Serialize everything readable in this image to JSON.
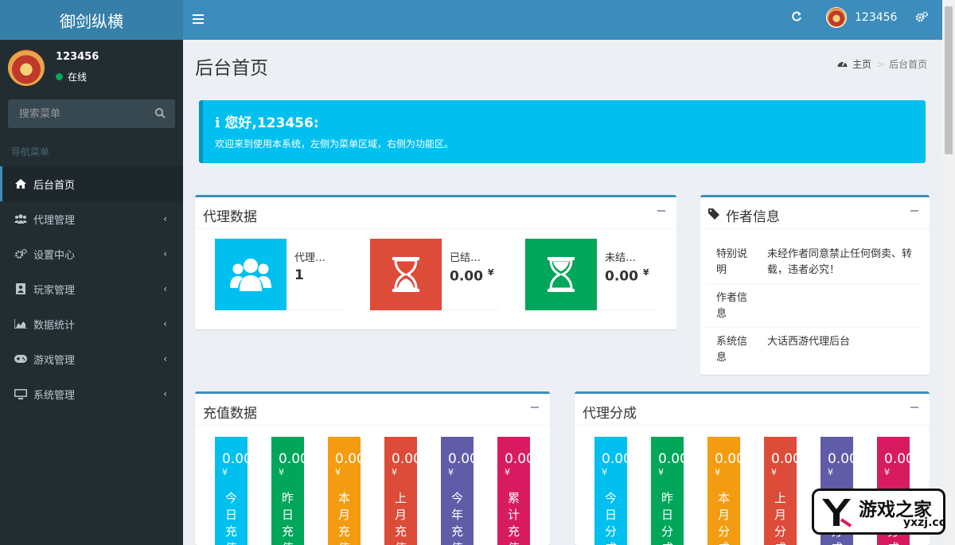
{
  "header": {
    "brand": "御剑纵横",
    "username": "123456"
  },
  "sidebar": {
    "user": {
      "name": "123456",
      "status": "在线"
    },
    "search_placeholder": "搜索菜单",
    "nav_header": "导航菜单",
    "items": [
      {
        "label": "后台首页",
        "icon": "home-icon",
        "active": true
      },
      {
        "label": "代理管理",
        "icon": "users-icon"
      },
      {
        "label": "设置中心",
        "icon": "cogs-icon"
      },
      {
        "label": "玩家管理",
        "icon": "contact-card-icon"
      },
      {
        "label": "数据统计",
        "icon": "area-chart-icon"
      },
      {
        "label": "游戏管理",
        "icon": "gamepad-icon"
      },
      {
        "label": "系统管理",
        "icon": "desktop-icon"
      }
    ]
  },
  "content": {
    "title": "后台首页",
    "breadcrumb": {
      "home": "主页",
      "current": "后台首页"
    },
    "callout": {
      "title": "您好,123456:",
      "text": "欢迎来到使用本系统，左侧为菜单区域，右侧为功能区。"
    },
    "agent_data": {
      "title": "代理数据",
      "boxes": [
        {
          "label": "代理…",
          "value": "1",
          "currency": "",
          "color": "#00c0ef",
          "icon": "users-icon"
        },
        {
          "label": "已结…",
          "value": "0.00",
          "currency": "¥",
          "color": "#dd4b39",
          "icon": "hourglass-end-icon"
        },
        {
          "label": "未结…",
          "value": "0.00",
          "currency": "¥",
          "color": "#00a65a",
          "icon": "hourglass-start-icon"
        }
      ]
    },
    "author_info": {
      "title": "作者信息",
      "rows": [
        {
          "key": "特别说明",
          "value": "未经作者同意禁止任何倒卖、转载，违者必究！"
        },
        {
          "key": "作者信息",
          "value": ""
        },
        {
          "key": "系统信息",
          "value": "大话西游代理后台"
        }
      ]
    },
    "recharge_data": {
      "title": "充值数据",
      "bars": [
        {
          "amount": "0.00",
          "currency": "¥",
          "label": "今日充值",
          "color": "#00c0ef"
        },
        {
          "amount": "0.00",
          "currency": "¥",
          "label": "昨日充值",
          "color": "#00a65a"
        },
        {
          "amount": "0.00",
          "currency": "¥",
          "label": "本月充值",
          "color": "#f39c12"
        },
        {
          "amount": "0.00",
          "currency": "¥",
          "label": "上月充值",
          "color": "#dd4b39"
        },
        {
          "amount": "0.00",
          "currency": "¥",
          "label": "今年充值",
          "color": "#605ca8"
        },
        {
          "amount": "0.00",
          "currency": "¥",
          "label": "累计充值",
          "color": "#d81b60"
        }
      ]
    },
    "agent_share": {
      "title": "代理分成",
      "bars": [
        {
          "amount": "0.00",
          "currency": "¥",
          "label": "今日分成",
          "color": "#00c0ef"
        },
        {
          "amount": "0.00",
          "currency": "¥",
          "label": "昨日分成",
          "color": "#00a65a"
        },
        {
          "amount": "0.00",
          "currency": "¥",
          "label": "本月分成",
          "color": "#f39c12"
        },
        {
          "amount": "0.00",
          "currency": "¥",
          "label": "上月分成",
          "color": "#dd4b39"
        },
        {
          "amount": "0.00",
          "currency": "¥",
          "label": "今年分成",
          "color": "#605ca8"
        },
        {
          "amount": "0.00",
          "currency": "¥",
          "label": "累计分成",
          "color": "#d81b60"
        }
      ]
    }
  },
  "watermark": {
    "text": "游戏之家",
    "url": "yxzj.cc"
  }
}
